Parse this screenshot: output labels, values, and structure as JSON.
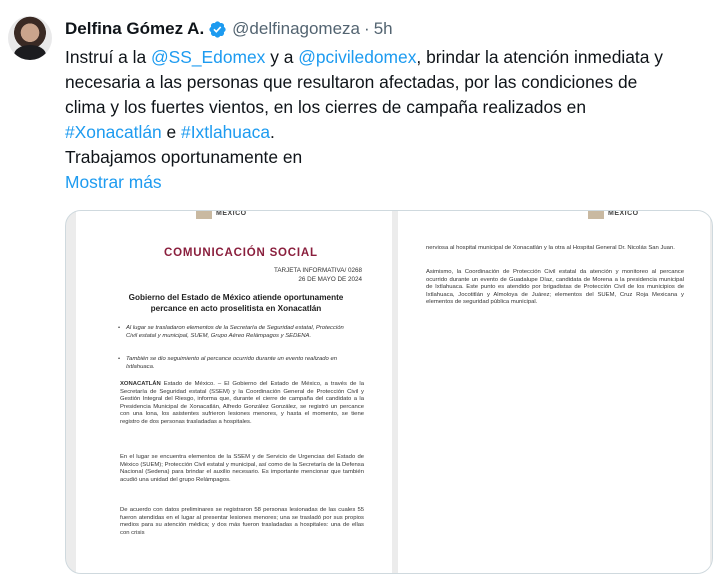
{
  "tweet": {
    "display_name": "Delfina Gómez A.",
    "handle": "@delfinagomeza",
    "separator": "·",
    "time": "5h",
    "segments": {
      "s1": "Instruí a la ",
      "mention1": "@SS_Edomex",
      "s2": " y a ",
      "mention2": "@pciviledomex",
      "s3": ", brindar la atención inmediata y",
      "line2": "necesaria a las personas que resultaron afectadas, por las condiciones de",
      "line3": "clima y los fuertes vientos, en los cierres de campaña realizados en",
      "hashtag1": "#Xonacatlán",
      "s4": " e ",
      "hashtag2": "#Ixtlahuaca",
      "s5": ".",
      "line5": "Trabajamos oportunamente en"
    },
    "show_more": "Mostrar más",
    "verified_icon": "verified-badge-icon",
    "accent_color": "#1d9bf0"
  },
  "document": {
    "logo_text": "MÉXICO",
    "title": "COMUNICACIÓN SOCIAL",
    "card_number": "TARJETA INFORMATIVA/ 0268",
    "date": "26 DE MAYO DE 2024",
    "heading": "Gobierno del Estado de México atiende oportunamente percance en acto proselitista en Xonacatlán",
    "bullet1": "Al lugar se trasladaron elementos de la Secretaría de Seguridad estatal, Protección Civil estatal y municipal, SUEM, Grupo Aéreo Relámpagos y SEDENA.",
    "bullet2": "También se dio seguimiento al percance ocurrido durante un evento realizado en Ixtlahuaca.",
    "p1_lead": "XONACATLÁN",
    "p1": " Estado de México. – El Gobierno del Estado de México, a través de la Secretaría de Seguridad estatal (SSEM) y la Coordinación General de Protección Civil y Gestión Integral del Riesgo, informa que, durante el cierre de campaña del candidato a la Presidencia Municipal de Xonacatlán, Alfredo González González, se registró un percance con una lona, los asistentes sufrieron lesiones menores, y hasta el momento, se tiene registro de dos personas trasladadas a hospitales.",
    "p2": "En el lugar se encuentra elementos de la SSEM y de Servicio de Urgencias del Estado de México (SUEM); Protección Civil estatal y municipal, así como de la Secretaría de la Defensa Nacional (Sedena) para brindar el auxilio necesario. Es importante mencionar que también acudió una unidad del grupo Relámpagos.",
    "p3": "De acuerdo con datos preliminares se registraron 58 personas lesionadas de las cuales 55 fueron atendidas en el lugar al presentar lesiones menores; una se trasladó por sus propios medios para su atención médica; y dos más fueron trasladadas a hospitales: una de ellas con crisis",
    "r1": "nerviosa al hospital municipal de Xonacatlán y la otra al Hospital General Dr. Nicolás San Juan.",
    "r2": "Asimismo, la Coordinación de Protección Civil estatal da atención y monitoreo al percance ocurrido durante un evento de Guadalupe Díaz, candidata de Morena a la presidencia municipal de Ixtlahuaca. Este punto es atendido por brigadistas de Protección Civil de los municipios de Ixtlahuaca, Jocotitlán y Almoloya de Juárez; elementos del SUEM, Cruz Roja Mexicana y elementos de seguridad pública municipal.",
    "title_color": "#8a1f3d"
  }
}
